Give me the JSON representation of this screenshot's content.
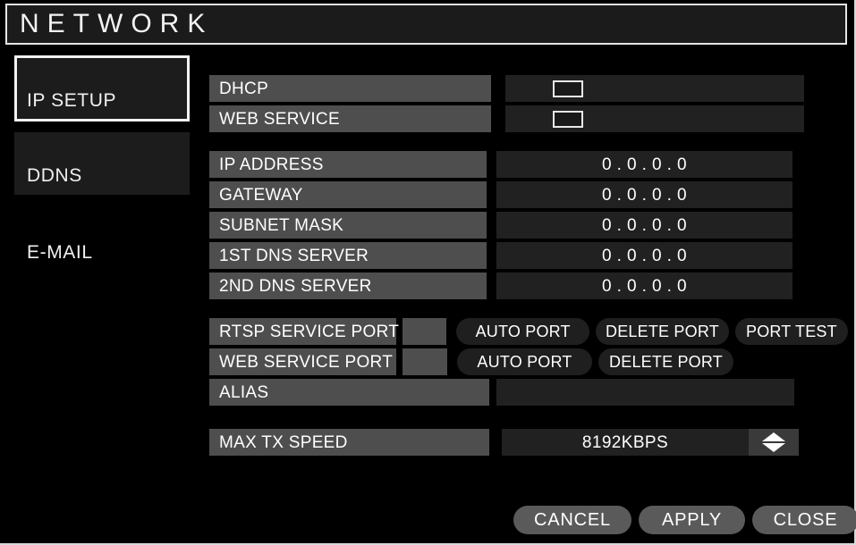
{
  "window": {
    "title": "NETWORK"
  },
  "sidebar": {
    "items": [
      {
        "label": "IP SETUP",
        "state": "selected"
      },
      {
        "label": "DDNS",
        "state": "dim"
      },
      {
        "label": "E-MAIL",
        "state": "plain"
      }
    ]
  },
  "panel": {
    "toggles": [
      {
        "label": "DHCP",
        "checked": false
      },
      {
        "label": "WEB SERVICE",
        "checked": false
      }
    ],
    "addresses": [
      {
        "label": "IP ADDRESS",
        "value": "0 . 0 . 0 . 0"
      },
      {
        "label": "GATEWAY",
        "value": "0 . 0 . 0 . 0"
      },
      {
        "label": "SUBNET MASK",
        "value": "0 . 0 . 0 . 0"
      },
      {
        "label": "1ST DNS SERVER",
        "value": "0 . 0 . 0 . 0"
      },
      {
        "label": "2ND DNS SERVER",
        "value": "0 . 0 . 0 . 0"
      }
    ],
    "ports": [
      {
        "label": "RTSP SERVICE PORT",
        "value": "",
        "buttons": [
          "AUTO PORT",
          "DELETE PORT",
          "PORT TEST"
        ]
      },
      {
        "label": "WEB SERVICE PORT",
        "value": "",
        "buttons": [
          "AUTO PORT",
          "DELETE PORT"
        ]
      }
    ],
    "alias": {
      "label": "ALIAS",
      "value": ""
    },
    "max_tx_speed": {
      "label": "MAX TX SPEED",
      "value": "8192KBPS",
      "spinner_up_icon": "triangle-up-icon",
      "spinner_down_icon": "triangle-down-icon"
    }
  },
  "footer": {
    "cancel_label": "CANCEL",
    "apply_label": "APPLY",
    "close_label": "CLOSE"
  },
  "colors": {
    "background": "#000000",
    "label_chip": "#4e4e4e",
    "value_field": "#212121",
    "pill_button": "#1f1f1f",
    "action_button": "#5a5a5a",
    "border": "#e6e6e6",
    "text": "#ffffff"
  }
}
